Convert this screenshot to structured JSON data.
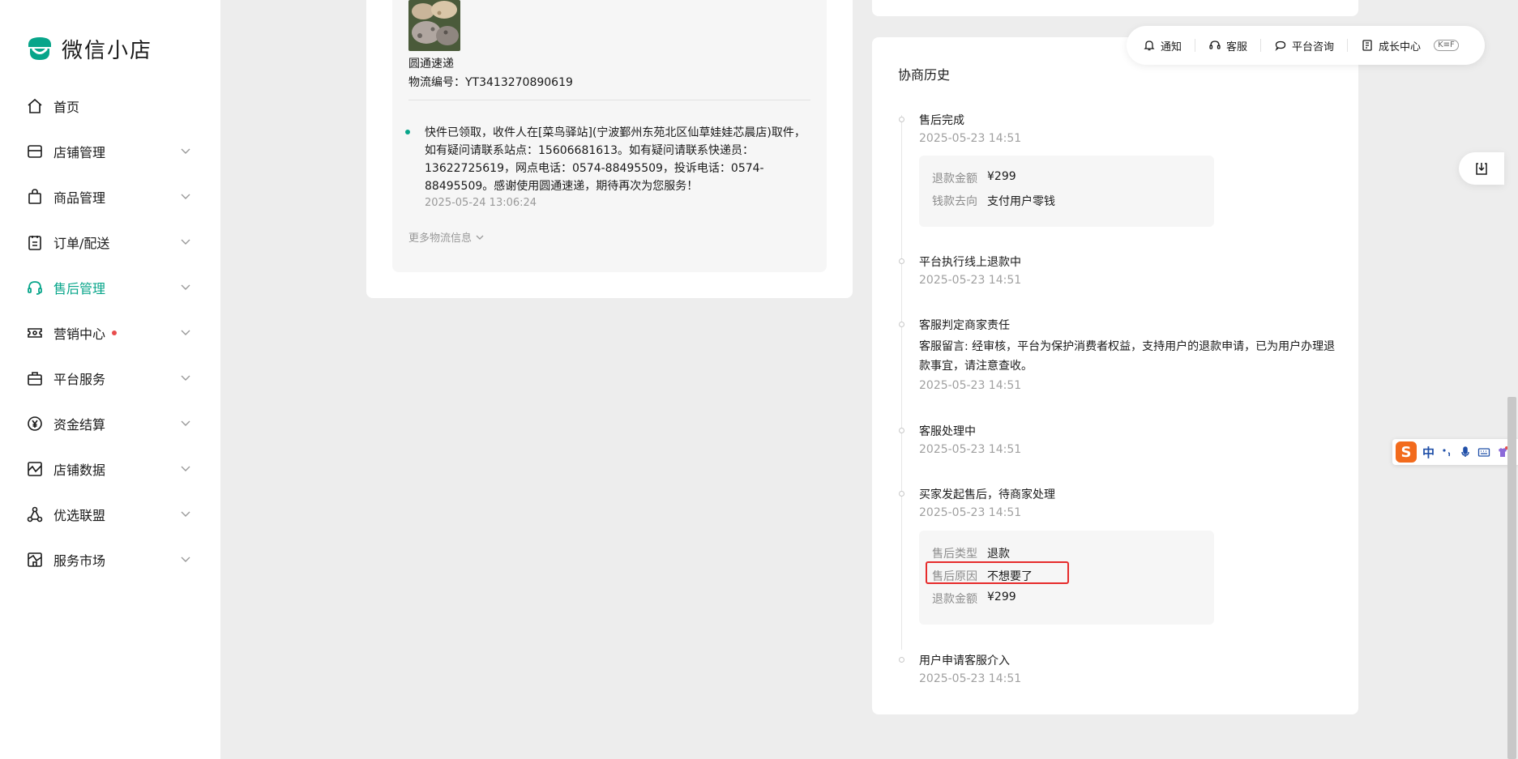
{
  "app": {
    "name": "微信小店"
  },
  "sidebar": {
    "items": [
      {
        "label": "首页",
        "icon": "home-icon",
        "active": false,
        "dot": false,
        "chevron": false
      },
      {
        "label": "店铺管理",
        "icon": "store-icon",
        "active": false,
        "dot": false,
        "chevron": true
      },
      {
        "label": "商品管理",
        "icon": "bag-icon",
        "active": false,
        "dot": false,
        "chevron": true
      },
      {
        "label": "订单/配送",
        "icon": "clipboard-icon",
        "active": false,
        "dot": false,
        "chevron": true
      },
      {
        "label": "售后管理",
        "icon": "headset-icon",
        "active": true,
        "dot": false,
        "chevron": true
      },
      {
        "label": "营销中心",
        "icon": "ticket-icon",
        "active": false,
        "dot": true,
        "chevron": true
      },
      {
        "label": "平台服务",
        "icon": "briefcase-icon",
        "active": false,
        "dot": false,
        "chevron": true
      },
      {
        "label": "资金结算",
        "icon": "yen-coin-icon",
        "active": false,
        "dot": false,
        "chevron": true
      },
      {
        "label": "店铺数据",
        "icon": "chart-icon",
        "active": false,
        "dot": false,
        "chevron": true
      },
      {
        "label": "优选联盟",
        "icon": "network-icon",
        "active": false,
        "dot": false,
        "chevron": true
      },
      {
        "label": "服务市场",
        "icon": "market-icon",
        "active": false,
        "dot": false,
        "chevron": true
      }
    ]
  },
  "logistics": {
    "carrier": "圆通速递",
    "tracking_label": "物流编号：",
    "tracking_number": "YT3413270890619",
    "event_text": "快件已领取，收件人在[菜鸟驿站](宁波鄞州东苑北区仙草娃娃芯晨店)取件，如有疑问请联系站点：15606681613。如有疑问请联系快递员：13622725619，网点电话：0574-88495509，投诉电话：0574-88495509。感谢使用圆通速递，期待再次为您服务！",
    "event_time": "2025-05-24 13:06:24",
    "more_label": "更多物流信息"
  },
  "history": {
    "title": "协商历史",
    "events": [
      {
        "title": "售后完成",
        "time": "2025-05-23 14:51",
        "details": [
          {
            "key": "退款金额",
            "value": "¥299"
          },
          {
            "key": "钱款去向",
            "value": "支付用户零钱"
          }
        ]
      },
      {
        "title": "平台执行线上退款中",
        "time": "2025-05-23 14:51"
      },
      {
        "title": "客服判定商家责任",
        "note": "客服留言: 经审核，平台为保护消费者权益，支持用户的退款申请，已为用户办理退款事宜，请注意查收。",
        "time": "2025-05-23 14:51"
      },
      {
        "title": "客服处理中",
        "time": "2025-05-23 14:51"
      },
      {
        "title": "买家发起售后，待商家处理",
        "time": "2025-05-23 14:51",
        "details": [
          {
            "key": "售后类型",
            "value": "退款"
          },
          {
            "key": "售后原因",
            "value": "不想要了"
          },
          {
            "key": "退款金额",
            "value": "¥299"
          }
        ]
      },
      {
        "title": "用户申请客服介入",
        "time": "2025-05-23 14:51"
      }
    ]
  },
  "toolbar": {
    "notify": "通知",
    "service": "客服",
    "consult": "平台咨询",
    "growth": "成长中心",
    "badge": "K≡F"
  },
  "ime": {
    "lang": "中"
  },
  "colors": {
    "accent": "#07a58a",
    "highlight": "#e62b2b",
    "dot_alert": "#e84d4d"
  }
}
